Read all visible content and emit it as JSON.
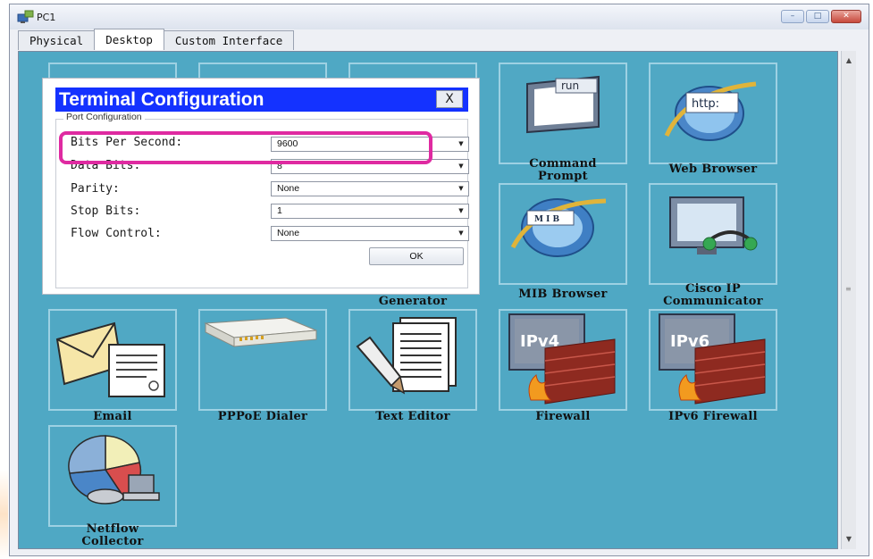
{
  "window": {
    "title": "PC1",
    "minimize": "–",
    "maximize": "□",
    "close": "✕"
  },
  "tabs": [
    {
      "label": "Physical",
      "active": false
    },
    {
      "label": "Desktop",
      "active": true
    },
    {
      "label": "Custom Interface",
      "active": false
    }
  ],
  "apps": {
    "command_prompt": {
      "label_line1": "Command",
      "label_line2": "Prompt",
      "screen_text": "run"
    },
    "web_browser": {
      "label": "Web Browser",
      "globe_text": "http:"
    },
    "mib_browser": {
      "label": "MIB Browser",
      "globe_text": "M I B"
    },
    "cisco_ip_communicator": {
      "label_line1": "Cisco IP",
      "label_line2": "Communicator"
    },
    "traffic_generator": {
      "label_visible": "Generator"
    },
    "email": {
      "label": "Email"
    },
    "pppoe_dialer": {
      "label": "PPPoE Dialer"
    },
    "text_editor": {
      "label": "Text Editor"
    },
    "firewall": {
      "label": "Firewall",
      "screen_text": "IPv4"
    },
    "ipv6_firewall": {
      "label": "IPv6 Firewall",
      "screen_text": "IPv6"
    },
    "netflow_collector": {
      "label_line1": "Netflow",
      "label_line2": "Collector"
    }
  },
  "dialog": {
    "title": "Terminal Configuration",
    "close_label": "X",
    "group_label": "Port Configuration",
    "fields": [
      {
        "label": "Bits Per Second:",
        "value": "9600"
      },
      {
        "label": "Data Bits:",
        "value": "8"
      },
      {
        "label": "Parity:",
        "value": "None"
      },
      {
        "label": "Stop Bits:",
        "value": "1"
      },
      {
        "label": "Flow Control:",
        "value": "None"
      }
    ],
    "ok_label": "OK"
  },
  "colors": {
    "desktop_bg": "#4fa8c4",
    "dialog_title_bg": "#1432ff",
    "highlight_border": "#df2aa1"
  },
  "scrollbar": {
    "up": "▲",
    "down": "▼",
    "grip": "≡"
  }
}
